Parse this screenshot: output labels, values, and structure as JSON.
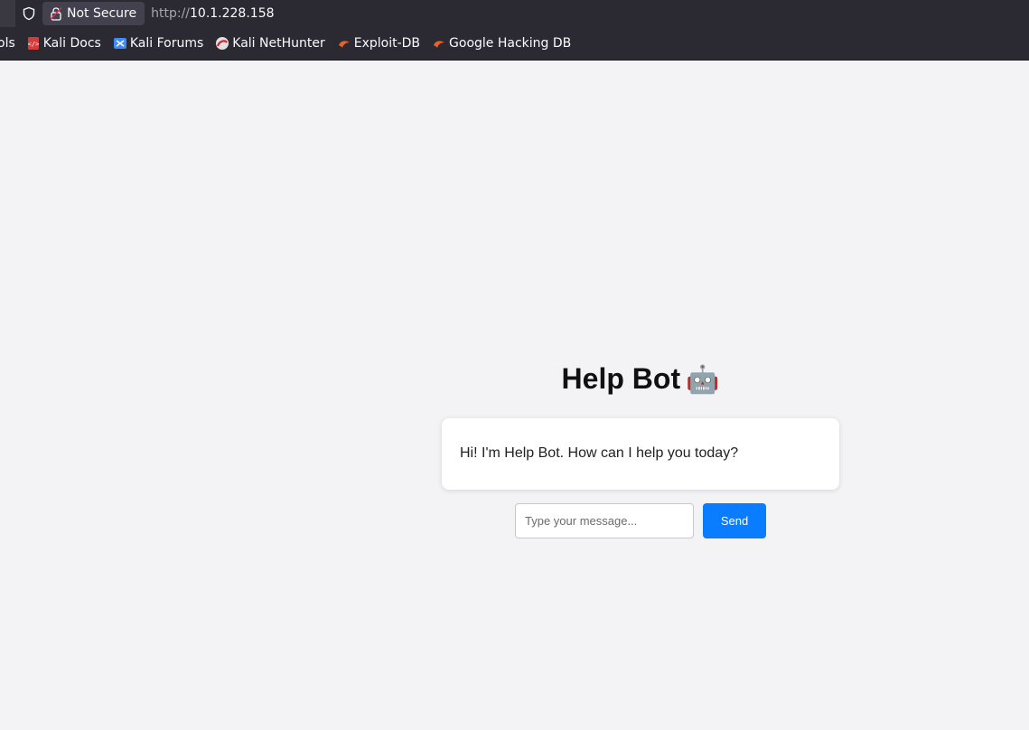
{
  "browser": {
    "security_label": "Not Secure",
    "url_scheme": "http://",
    "url_host": "10.1.228.158"
  },
  "bookmarks": [
    {
      "label": "ols",
      "icon": "truncated"
    },
    {
      "label": "Kali Docs",
      "icon": "kali-docs-icon"
    },
    {
      "label": "Kali Forums",
      "icon": "kali-forums-icon"
    },
    {
      "label": "Kali NetHunter",
      "icon": "kali-nethunter-icon"
    },
    {
      "label": "Exploit-DB",
      "icon": "exploit-db-icon"
    },
    {
      "label": "Google Hacking DB",
      "icon": "google-hacking-db-icon"
    }
  ],
  "app": {
    "title": "Help Bot",
    "title_emoji": "🤖",
    "bot_message": "Hi! I'm Help Bot. How can I help you today?",
    "input_placeholder": "Type your message...",
    "input_value": "",
    "send_label": "Send"
  },
  "colors": {
    "accent": "#0a7cff",
    "toolbar": "#2b2a33",
    "page_bg": "#f3f3f5"
  }
}
